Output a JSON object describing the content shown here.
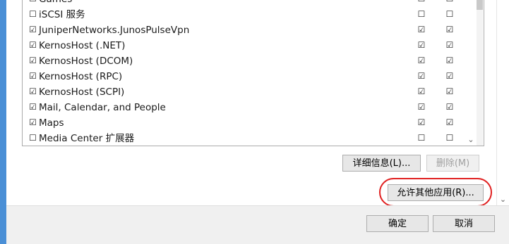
{
  "window": {
    "accent_color": "#4a8fd6"
  },
  "apps_list": {
    "rows": [
      {
        "name": "Games",
        "checked": false,
        "col1": false,
        "col2": false
      },
      {
        "name": "iSCSI 服务",
        "checked": false,
        "col1": false,
        "col2": false
      },
      {
        "name": "JuniperNetworks.JunosPulseVpn",
        "checked": true,
        "col1": true,
        "col2": true
      },
      {
        "name": "KernosHost (.NET)",
        "checked": true,
        "col1": true,
        "col2": true
      },
      {
        "name": "KernosHost (DCOM)",
        "checked": true,
        "col1": true,
        "col2": true
      },
      {
        "name": "KernosHost (RPC)",
        "checked": true,
        "col1": true,
        "col2": true
      },
      {
        "name": "KernosHost (SCPI)",
        "checked": true,
        "col1": true,
        "col2": true
      },
      {
        "name": "Mail, Calendar, and People",
        "checked": true,
        "col1": true,
        "col2": true
      },
      {
        "name": "Maps",
        "checked": true,
        "col1": true,
        "col2": true
      },
      {
        "name": "Media Center 扩展器",
        "checked": false,
        "col1": false,
        "col2": false
      }
    ]
  },
  "buttons": {
    "details": "详细信息(L)...",
    "delete": "删除(M)",
    "allow_other_app": "允许其他应用(R)...",
    "ok": "确定",
    "cancel": "取消"
  },
  "icons": {
    "checked": "☑",
    "unchecked": "☐",
    "scroll_down": "⌄"
  },
  "highlight_color": "#e02020"
}
